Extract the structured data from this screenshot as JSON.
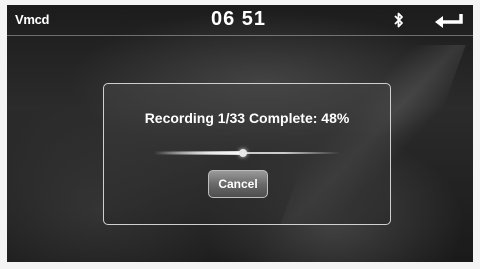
{
  "status_bar": {
    "source": "Vmcd",
    "time": "06 51",
    "bluetooth_icon": "bluetooth-icon",
    "back_icon": "back-arrow-icon"
  },
  "dialog": {
    "message": "Recording 1/33 Complete: 48%",
    "progress_fraction": 0.48,
    "cancel_label": "Cancel"
  },
  "colors": {
    "background": "#1c1c1c",
    "text": "#ffffff",
    "dialog_border": "#ebebeb"
  }
}
